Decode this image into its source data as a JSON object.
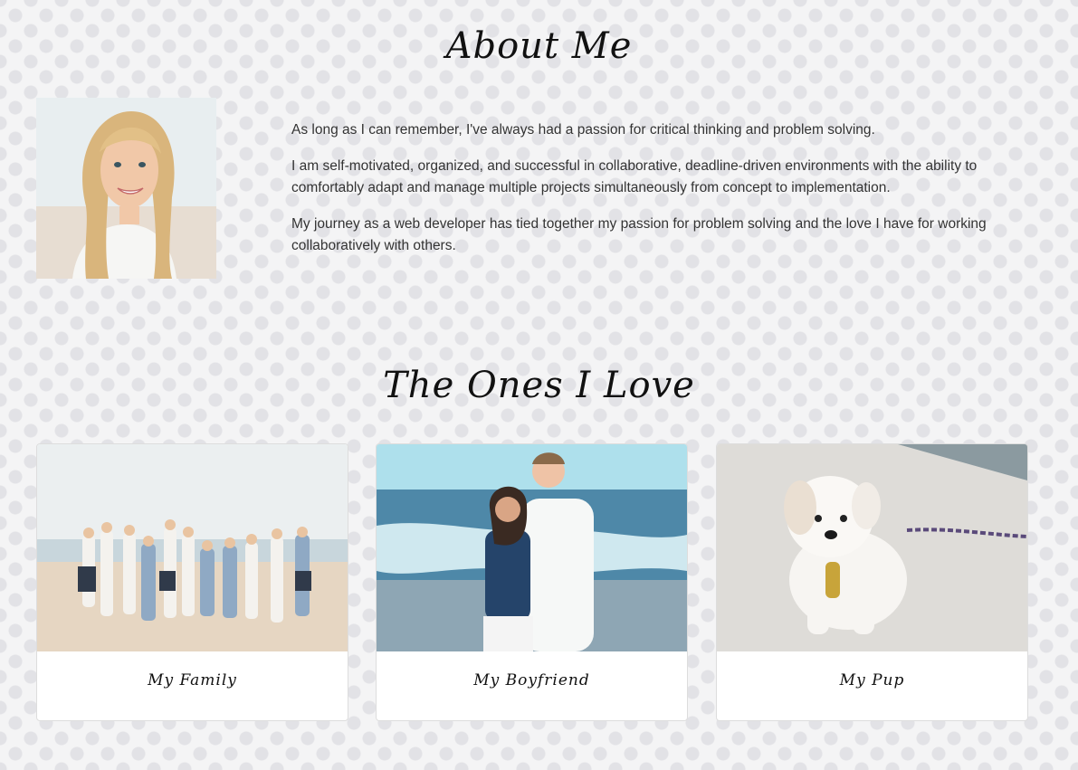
{
  "about": {
    "title": "About Me",
    "paragraphs": [
      "As long as I can remember, I've always had a passion for critical thinking and problem solving.",
      "I am self-motivated, organized, and successful in collaborative, deadline-driven environments with the ability to comfortably adapt and manage multiple projects simultaneously from concept to implementation.",
      "My journey as a web developer has tied together my passion for problem solving and the love I have for working collaboratively with others."
    ]
  },
  "loved": {
    "title": "The Ones I Love",
    "cards": [
      {
        "caption": "My Family"
      },
      {
        "caption": "My Boyfriend"
      },
      {
        "caption": "My Pup"
      }
    ]
  }
}
